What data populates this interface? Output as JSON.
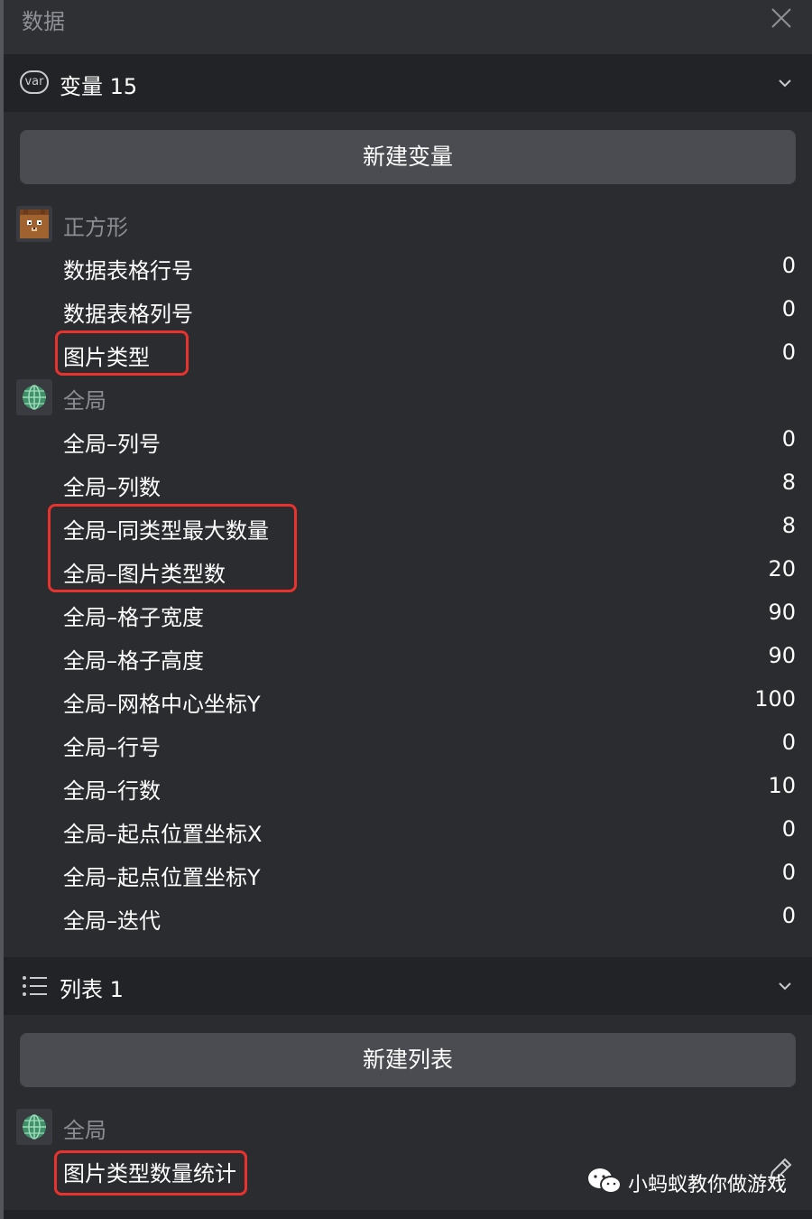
{
  "panel": {
    "title": "数据"
  },
  "variables_section": {
    "label": "变量 15",
    "new_button": "新建变量",
    "sprite_group": {
      "name": "正方形",
      "items": [
        {
          "name": "数据表格行号",
          "value": "0"
        },
        {
          "name": "数据表格列号",
          "value": "0"
        },
        {
          "name": "图片类型",
          "value": "0"
        }
      ]
    },
    "global_group": {
      "name": "全局",
      "items": [
        {
          "name": "全局–列号",
          "value": "0"
        },
        {
          "name": "全局–列数",
          "value": "8"
        },
        {
          "name": "全局–同类型最大数量",
          "value": "8"
        },
        {
          "name": "全局–图片类型数",
          "value": "20"
        },
        {
          "name": "全局–格子宽度",
          "value": "90"
        },
        {
          "name": "全局–格子高度",
          "value": "90"
        },
        {
          "name": "全局–网格中心坐标Y",
          "value": "100"
        },
        {
          "name": "全局–行号",
          "value": "0"
        },
        {
          "name": "全局–行数",
          "value": "10"
        },
        {
          "name": "全局–起点位置坐标X",
          "value": "0"
        },
        {
          "name": "全局–起点位置坐标Y",
          "value": "0"
        },
        {
          "name": "全局–迭代",
          "value": "0"
        }
      ]
    }
  },
  "lists_section": {
    "label": "列表 1",
    "new_button": "新建列表",
    "global_group": {
      "name": "全局",
      "items": [
        {
          "name": "图片类型数量统计"
        }
      ]
    }
  },
  "watermark": {
    "text": "小蚂蚁教你做游戏"
  },
  "icons": {
    "close": "close-icon",
    "variable": "var-icon",
    "list": "list-icon",
    "global": "globe-icon",
    "sprite": "bear-sprite-icon",
    "edit": "pencil-icon",
    "chevron": "chevron-down-icon",
    "wechat": "wechat-icon"
  },
  "colors": {
    "highlight": "#e8322d",
    "panel_bg": "#2b2c30",
    "section_bg": "#222327",
    "button_bg": "#4b4c51"
  }
}
